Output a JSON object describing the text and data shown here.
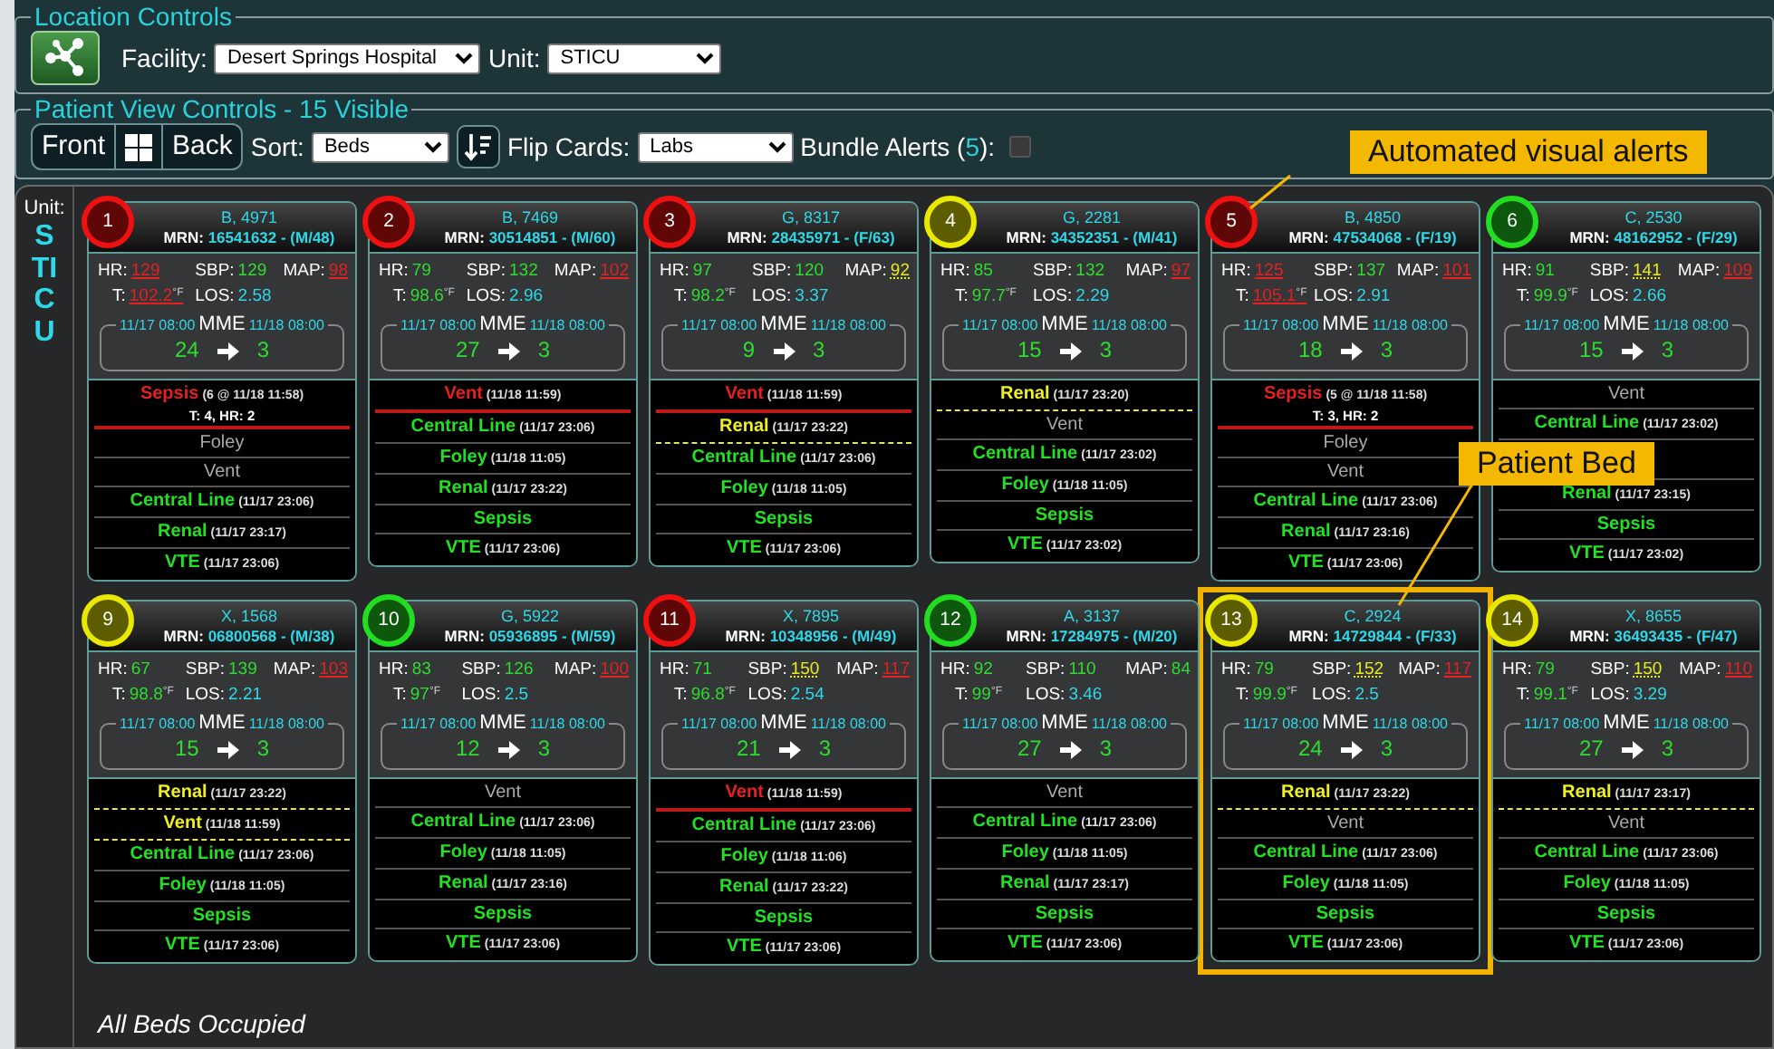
{
  "location_controls": {
    "legend": "Location Controls",
    "facility_label": "Facility:",
    "facility": "Desert Springs Hospital",
    "unit_label": "Unit:",
    "unit": "STICU"
  },
  "view_controls": {
    "legend": "Patient View Controls - 15 Visible",
    "front": "Front",
    "back": "Back",
    "sort_label": "Sort:",
    "sort": "Beds",
    "flip_label": "Flip Cards:",
    "flip": "Labs",
    "bundle_prefix": "Bundle Alerts (",
    "bundle_count": "5",
    "bundle_suffix": "):",
    "bundle_checked": false
  },
  "unit_panel": {
    "label": "Unit:",
    "unit": "STICU"
  },
  "card_rows": [
    {
      "cards": [
        {
          "bed": "1",
          "color": "#ee1111",
          "highlighted": false,
          "name": "B, 4971",
          "mrn_label": "MRN:",
          "mrn": "16541632 - (M/48)",
          "vitals": [
            {
              "label": "HR:",
              "value": "129",
              "kind": "high"
            },
            {
              "label": "SBP:",
              "value": "129",
              "kind": "normal"
            },
            {
              "label": "MAP:",
              "value": "98",
              "kind": "high"
            },
            {
              "label": "T:",
              "value": "102.2$^{°F}$",
              "kind": "high"
            },
            {
              "label": "LOS:",
              "value": "2.58",
              "kind": "info"
            }
          ],
          "mme": {
            "start": "11/17 08:00",
            "label": "MME",
            "end": "11/18 08:00",
            "from": "24",
            "to": "3"
          },
          "bundles": [
            {
              "label": "Sepsis",
              "time": "(6 @ 11/18 11:58)",
              "kind": "alert",
              "detail": "T: 4, HR: 2"
            },
            {
              "label": "Foley",
              "kind": "inactive"
            },
            {
              "label": "Vent",
              "kind": "inactive"
            },
            {
              "label": "Central Line",
              "time": "(11/17 23:06)",
              "kind": "ok"
            },
            {
              "label": "Renal",
              "time": "(11/17 23:17)",
              "kind": "ok"
            },
            {
              "label": "VTE",
              "time": "(11/17 23:06)",
              "kind": "ok"
            }
          ]
        },
        {
          "bed": "2",
          "color": "#ee1111",
          "highlighted": false,
          "name": "B, 7469",
          "mrn_label": "MRN:",
          "mrn": "30514851 - (M/60)",
          "vitals": [
            {
              "label": "HR:",
              "value": "79",
              "kind": "normal"
            },
            {
              "label": "SBP:",
              "value": "132",
              "kind": "normal"
            },
            {
              "label": "MAP:",
              "value": "102",
              "kind": "high"
            },
            {
              "label": "T:",
              "value": "98.6$^{°F}$",
              "kind": "normal"
            },
            {
              "label": "LOS:",
              "value": "2.96",
              "kind": "info"
            }
          ],
          "mme": {
            "start": "11/17 08:00",
            "label": "MME",
            "end": "11/18 08:00",
            "from": "27",
            "to": "3"
          },
          "bundles": [
            {
              "label": "Vent",
              "time": "(11/18 11:59)",
              "kind": "alert"
            },
            {
              "label": "Central Line",
              "time": "(11/17 23:06)",
              "kind": "ok"
            },
            {
              "label": "Foley",
              "time": "(11/18 11:05)",
              "kind": "ok"
            },
            {
              "label": "Renal",
              "time": "(11/17 23:22)",
              "kind": "ok"
            },
            {
              "label": "Sepsis",
              "kind": "ok"
            },
            {
              "label": "VTE",
              "time": "(11/17 23:06)",
              "kind": "ok"
            }
          ]
        },
        {
          "bed": "3",
          "color": "#ee1111",
          "highlighted": false,
          "name": "G, 8317",
          "mrn_label": "MRN:",
          "mrn": "28435971 - (F/63)",
          "vitals": [
            {
              "label": "HR:",
              "value": "97",
              "kind": "normal"
            },
            {
              "label": "SBP:",
              "value": "120",
              "kind": "normal"
            },
            {
              "label": "MAP:",
              "value": "92",
              "kind": "warn"
            },
            {
              "label": "T:",
              "value": "98.2$^{°F}$",
              "kind": "normal"
            },
            {
              "label": "LOS:",
              "value": "3.37",
              "kind": "info"
            }
          ],
          "mme": {
            "start": "11/17 08:00",
            "label": "MME",
            "end": "11/18 08:00",
            "from": "9",
            "to": "3"
          },
          "bundles": [
            {
              "label": "Vent",
              "time": "(11/18 11:59)",
              "kind": "alert"
            },
            {
              "label": "Renal",
              "time": "(11/17 23:22)",
              "kind": "warn"
            },
            {
              "label": "Central Line",
              "time": "(11/17 23:06)",
              "kind": "ok"
            },
            {
              "label": "Foley",
              "time": "(11/18 11:05)",
              "kind": "ok"
            },
            {
              "label": "Sepsis",
              "kind": "ok"
            },
            {
              "label": "VTE",
              "time": "(11/17 23:06)",
              "kind": "ok"
            }
          ]
        },
        {
          "bed": "4",
          "color": "#e8e800",
          "highlighted": false,
          "name": "G, 2281",
          "mrn_label": "MRN:",
          "mrn": "34352351 - (M/41)",
          "vitals": [
            {
              "label": "HR:",
              "value": "85",
              "kind": "normal"
            },
            {
              "label": "SBP:",
              "value": "132",
              "kind": "normal"
            },
            {
              "label": "MAP:",
              "value": "97",
              "kind": "high"
            },
            {
              "label": "T:",
              "value": "97.7$^{°F}$",
              "kind": "normal"
            },
            {
              "label": "LOS:",
              "value": "2.29",
              "kind": "info"
            }
          ],
          "mme": {
            "start": "11/17 08:00",
            "label": "MME",
            "end": "11/18 08:00",
            "from": "15",
            "to": "3"
          },
          "bundles": [
            {
              "label": "Renal",
              "time": "(11/17 23:20)",
              "kind": "warn"
            },
            {
              "label": "Vent",
              "kind": "inactive"
            },
            {
              "label": "Central Line",
              "time": "(11/17 23:02)",
              "kind": "ok"
            },
            {
              "label": "Foley",
              "time": "(11/18 11:05)",
              "kind": "ok"
            },
            {
              "label": "Sepsis",
              "kind": "ok"
            },
            {
              "label": "VTE",
              "time": "(11/17 23:02)",
              "kind": "ok"
            }
          ]
        },
        {
          "bed": "5",
          "color": "#ee1111",
          "highlighted": false,
          "name": "B, 4850",
          "mrn_label": "MRN:",
          "mrn": "47534068 - (F/19)",
          "vitals": [
            {
              "label": "HR:",
              "value": "125",
              "kind": "high"
            },
            {
              "label": "SBP:",
              "value": "137",
              "kind": "normal"
            },
            {
              "label": "MAP:",
              "value": "101",
              "kind": "high"
            },
            {
              "label": "T:",
              "value": "105.1$^{°F}$",
              "kind": "high"
            },
            {
              "label": "LOS:",
              "value": "2.91",
              "kind": "info"
            }
          ],
          "mme": {
            "start": "11/17 08:00",
            "label": "MME",
            "end": "11/18 08:00",
            "from": "18",
            "to": "3"
          },
          "bundles": [
            {
              "label": "Sepsis",
              "time": "(5 @ 11/18 11:58)",
              "kind": "alert",
              "detail": "T: 3, HR: 2"
            },
            {
              "label": "Foley",
              "kind": "inactive"
            },
            {
              "label": "Vent",
              "kind": "inactive"
            },
            {
              "label": "Central Line",
              "time": "(11/17 23:06)",
              "kind": "ok"
            },
            {
              "label": "Renal",
              "time": "(11/17 23:16)",
              "kind": "ok"
            },
            {
              "label": "VTE",
              "time": "(11/17 23:06)",
              "kind": "ok"
            }
          ]
        },
        {
          "bed": "6",
          "color": "#22dd22",
          "highlighted": false,
          "name": "C, 2530",
          "mrn_label": "MRN:",
          "mrn": "48162952 - (F/29)",
          "vitals": [
            {
              "label": "HR:",
              "value": "91",
              "kind": "normal"
            },
            {
              "label": "SBP:",
              "value": "141",
              "kind": "warn"
            },
            {
              "label": "MAP:",
              "value": "109",
              "kind": "high"
            },
            {
              "label": "T:",
              "value": "99.9$^{°F}$",
              "kind": "normal"
            },
            {
              "label": "LOS:",
              "value": "2.66",
              "kind": "info"
            }
          ],
          "mme": {
            "start": "11/17 08:00",
            "label": "MME",
            "end": "11/18 08:00",
            "from": "15",
            "to": "3"
          },
          "bundles": [
            {
              "label": "Vent",
              "kind": "inactive"
            },
            {
              "label": "Central Line",
              "time": "(11/17 23:02)",
              "kind": "ok"
            },
            {
              "kind": "covered"
            },
            {
              "label": "Renal",
              "time": "(11/17 23:15)",
              "kind": "ok"
            },
            {
              "label": "Sepsis",
              "kind": "ok"
            },
            {
              "label": "VTE",
              "time": "(11/17 23:02)",
              "kind": "ok"
            }
          ]
        }
      ]
    },
    {
      "cards": [
        {
          "bed": "9",
          "color": "#e8e800",
          "highlighted": false,
          "name": "X, 1568",
          "mrn_label": "MRN:",
          "mrn": "06800568 - (M/38)",
          "vitals": [
            {
              "label": "HR:",
              "value": "67",
              "kind": "normal"
            },
            {
              "label": "SBP:",
              "value": "139",
              "kind": "normal"
            },
            {
              "label": "MAP:",
              "value": "103",
              "kind": "high"
            },
            {
              "label": "T:",
              "value": "98.8$^{°F}$",
              "kind": "normal"
            },
            {
              "label": "LOS:",
              "value": "2.21",
              "kind": "info"
            }
          ],
          "mme": {
            "start": "11/17 08:00",
            "label": "MME",
            "end": "11/18 08:00",
            "from": "15",
            "to": "3"
          },
          "bundles": [
            {
              "label": "Renal",
              "time": "(11/17 23:22)",
              "kind": "warn"
            },
            {
              "label": "Vent",
              "time": "(11/18 11:59)",
              "kind": "warn"
            },
            {
              "label": "Central Line",
              "time": "(11/17 23:06)",
              "kind": "ok"
            },
            {
              "label": "Foley",
              "time": "(11/18 11:05)",
              "kind": "ok"
            },
            {
              "label": "Sepsis",
              "kind": "ok"
            },
            {
              "label": "VTE",
              "time": "(11/17 23:06)",
              "kind": "ok"
            }
          ]
        },
        {
          "bed": "10",
          "color": "#22dd22",
          "highlighted": false,
          "name": "G, 5922",
          "mrn_label": "MRN:",
          "mrn": "05936895 - (M/59)",
          "vitals": [
            {
              "label": "HR:",
              "value": "83",
              "kind": "normal"
            },
            {
              "label": "SBP:",
              "value": "126",
              "kind": "normal"
            },
            {
              "label": "MAP:",
              "value": "100",
              "kind": "high"
            },
            {
              "label": "T:",
              "value": "97$^{°F}$",
              "kind": "normal"
            },
            {
              "label": "LOS:",
              "value": "2.5",
              "kind": "info"
            }
          ],
          "mme": {
            "start": "11/17 08:00",
            "label": "MME",
            "end": "11/18 08:00",
            "from": "12",
            "to": "3"
          },
          "bundles": [
            {
              "label": "Vent",
              "kind": "inactive"
            },
            {
              "label": "Central Line",
              "time": "(11/17 23:06)",
              "kind": "ok"
            },
            {
              "label": "Foley",
              "time": "(11/18 11:05)",
              "kind": "ok"
            },
            {
              "label": "Renal",
              "time": "(11/17 23:16)",
              "kind": "ok"
            },
            {
              "label": "Sepsis",
              "kind": "ok"
            },
            {
              "label": "VTE",
              "time": "(11/17 23:06)",
              "kind": "ok"
            }
          ]
        },
        {
          "bed": "11",
          "color": "#ee1111",
          "highlighted": false,
          "name": "X, 7895",
          "mrn_label": "MRN:",
          "mrn": "10348956 - (M/49)",
          "vitals": [
            {
              "label": "HR:",
              "value": "71",
              "kind": "normal"
            },
            {
              "label": "SBP:",
              "value": "150",
              "kind": "warn"
            },
            {
              "label": "MAP:",
              "value": "117",
              "kind": "high"
            },
            {
              "label": "T:",
              "value": "96.8$^{°F}$",
              "kind": "normal"
            },
            {
              "label": "LOS:",
              "value": "2.54",
              "kind": "info"
            }
          ],
          "mme": {
            "start": "11/17 08:00",
            "label": "MME",
            "end": "11/18 08:00",
            "from": "21",
            "to": "3"
          },
          "bundles": [
            {
              "label": "Vent",
              "time": "(11/18 11:59)",
              "kind": "alert"
            },
            {
              "label": "Central Line",
              "time": "(11/17 23:06)",
              "kind": "ok"
            },
            {
              "label": "Foley",
              "time": "(11/18 11:06)",
              "kind": "ok"
            },
            {
              "label": "Renal",
              "time": "(11/17 23:22)",
              "kind": "ok"
            },
            {
              "label": "Sepsis",
              "kind": "ok"
            },
            {
              "label": "VTE",
              "time": "(11/17 23:06)",
              "kind": "ok"
            }
          ]
        },
        {
          "bed": "12",
          "color": "#22dd22",
          "highlighted": false,
          "name": "A, 3137",
          "mrn_label": "MRN:",
          "mrn": "17284975 - (M/20)",
          "vitals": [
            {
              "label": "HR:",
              "value": "92",
              "kind": "normal"
            },
            {
              "label": "SBP:",
              "value": "110",
              "kind": "normal"
            },
            {
              "label": "MAP:",
              "value": "84",
              "kind": "normal"
            },
            {
              "label": "T:",
              "value": "99$^{°F}$",
              "kind": "normal"
            },
            {
              "label": "LOS:",
              "value": "3.46",
              "kind": "info"
            }
          ],
          "mme": {
            "start": "11/17 08:00",
            "label": "MME",
            "end": "11/18 08:00",
            "from": "27",
            "to": "3"
          },
          "bundles": [
            {
              "label": "Vent",
              "kind": "inactive"
            },
            {
              "label": "Central Line",
              "time": "(11/17 23:06)",
              "kind": "ok"
            },
            {
              "label": "Foley",
              "time": "(11/18 11:05)",
              "kind": "ok"
            },
            {
              "label": "Renal",
              "time": "(11/17 23:17)",
              "kind": "ok"
            },
            {
              "label": "Sepsis",
              "kind": "ok"
            },
            {
              "label": "VTE",
              "time": "(11/17 23:06)",
              "kind": "ok"
            }
          ]
        },
        {
          "bed": "13",
          "color": "#e8e800",
          "highlighted": true,
          "name": "C, 2924",
          "mrn_label": "MRN:",
          "mrn": "14729844 - (F/33)",
          "vitals": [
            {
              "label": "HR:",
              "value": "79",
              "kind": "normal"
            },
            {
              "label": "SBP:",
              "value": "152",
              "kind": "warn"
            },
            {
              "label": "MAP:",
              "value": "117",
              "kind": "high"
            },
            {
              "label": "T:",
              "value": "99.9$^{°F}$",
              "kind": "normal"
            },
            {
              "label": "LOS:",
              "value": "2.5",
              "kind": "info"
            }
          ],
          "mme": {
            "start": "11/17 08:00",
            "label": "MME",
            "end": "11/18 08:00",
            "from": "24",
            "to": "3"
          },
          "bundles": [
            {
              "label": "Renal",
              "time": "(11/17 23:22)",
              "kind": "warn"
            },
            {
              "label": "Vent",
              "kind": "inactive"
            },
            {
              "label": "Central Line",
              "time": "(11/17 23:06)",
              "kind": "ok"
            },
            {
              "label": "Foley",
              "time": "(11/18 11:05)",
              "kind": "ok"
            },
            {
              "label": "Sepsis",
              "kind": "ok"
            },
            {
              "label": "VTE",
              "time": "(11/17 23:06)",
              "kind": "ok"
            }
          ]
        },
        {
          "bed": "14",
          "color": "#e8e800",
          "highlighted": false,
          "name": "X, 8655",
          "mrn_label": "MRN:",
          "mrn": "36493435 - (F/47)",
          "vitals": [
            {
              "label": "HR:",
              "value": "79",
              "kind": "normal"
            },
            {
              "label": "SBP:",
              "value": "150",
              "kind": "warn"
            },
            {
              "label": "MAP:",
              "value": "110",
              "kind": "high"
            },
            {
              "label": "T:",
              "value": "99.1$^{°F}$",
              "kind": "normal"
            },
            {
              "label": "LOS:",
              "value": "3.29",
              "kind": "info"
            }
          ],
          "mme": {
            "start": "11/17 08:00",
            "label": "MME",
            "end": "11/18 08:00",
            "from": "27",
            "to": "3"
          },
          "bundles": [
            {
              "label": "Renal",
              "time": "(11/17 23:17)",
              "kind": "warn"
            },
            {
              "label": "Vent",
              "kind": "inactive"
            },
            {
              "label": "Central Line",
              "time": "(11/17 23:06)",
              "kind": "ok"
            },
            {
              "label": "Foley",
              "time": "(11/18 11:05)",
              "kind": "ok"
            },
            {
              "label": "Sepsis",
              "kind": "ok"
            },
            {
              "label": "VTE",
              "time": "(11/17 23:06)",
              "kind": "ok"
            }
          ]
        }
      ]
    }
  ],
  "footer": "All Beds Occupied",
  "callouts": [
    {
      "text": "Automated visual alerts"
    },
    {
      "text": "Patient Bed"
    }
  ]
}
